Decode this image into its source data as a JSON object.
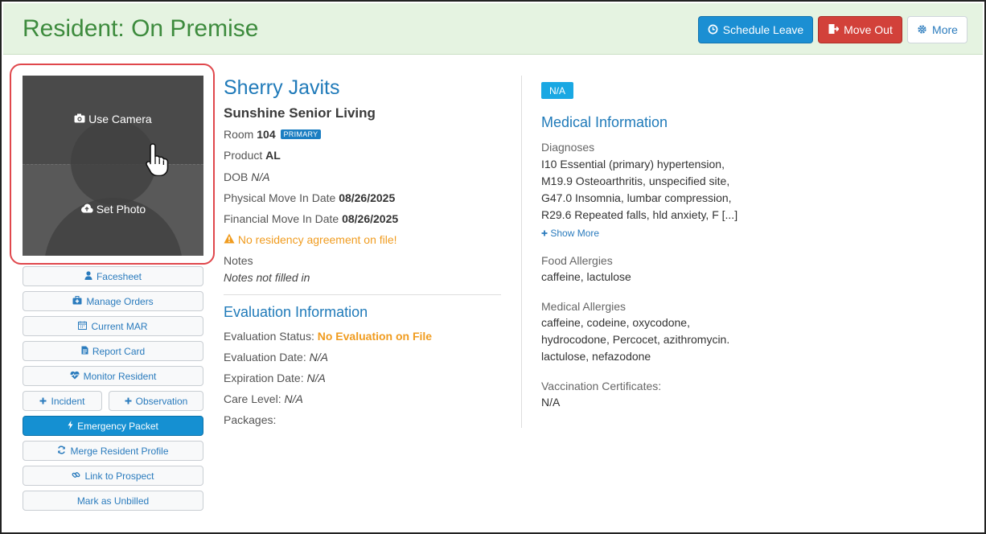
{
  "header": {
    "title": "Resident: On Premise",
    "schedule_leave": "Schedule Leave",
    "move_out": "Move Out",
    "more": "More"
  },
  "photo": {
    "use_camera": "Use Camera",
    "set_photo": "Set Photo"
  },
  "sidebar": {
    "facesheet": "Facesheet",
    "manage_orders": "Manage Orders",
    "current_mar": "Current MAR",
    "report_card": "Report Card",
    "monitor_resident": "Monitor Resident",
    "incident": "Incident",
    "observation": "Observation",
    "emergency_packet": "Emergency Packet",
    "merge_profile": "Merge Resident Profile",
    "link_prospect": "Link to Prospect",
    "mark_unbilled": "Mark as Unbilled"
  },
  "resident": {
    "name": "Sherry Javits",
    "facility": "Sunshine Senior Living",
    "room_label": "Room",
    "room": "104",
    "room_badge": "PRIMARY",
    "product_label": "Product",
    "product": "AL",
    "dob_label": "DOB",
    "dob": "N/A",
    "physical_label": "Physical Move In Date",
    "physical_date": "08/26/2025",
    "financial_label": "Financial Move In Date",
    "financial_date": "08/26/2025",
    "warning": "No residency agreement on file!",
    "notes_label": "Notes",
    "notes": "Notes not filled in"
  },
  "evaluation": {
    "title": "Evaluation Information",
    "status_label": "Evaluation Status:",
    "status": "No Evaluation on File",
    "date_label": "Evaluation Date:",
    "date": "N/A",
    "expiration_label": "Expiration Date:",
    "expiration": "N/A",
    "care_label": "Care Level:",
    "care": "N/A",
    "packages_label": "Packages:"
  },
  "medical": {
    "badge": "N/A",
    "title": "Medical Information",
    "diagnoses_label": "Diagnoses",
    "diagnoses_lines": [
      "I10 Essential (primary) hypertension,",
      "M19.9 Osteoarthritis, unspecified site,",
      "G47.0 Insomnia, lumbar compression,",
      "R29.6 Repeated falls, hld anxiety, F [...]"
    ],
    "show_more": "Show More",
    "food_label": "Food Allergies",
    "food": "caffeine, lactulose",
    "med_allergies_label": "Medical Allergies",
    "med_allergies_lines": [
      "caffeine, codeine, oxycodone,",
      "hydrocodone, Percocet, azithromycin.",
      "lactulose, nefazodone"
    ],
    "vacc_label": "Vaccination Certificates:",
    "vacc": "N/A"
  },
  "colors": {
    "header_bg": "#e5f3e1",
    "title_green": "#3d8b3d",
    "primary_blue": "#1b8fd3",
    "danger_red": "#d2413a",
    "link_blue": "#1f7ab9",
    "warning_orange": "#f09c20",
    "highlight_outline": "#e0474c"
  }
}
